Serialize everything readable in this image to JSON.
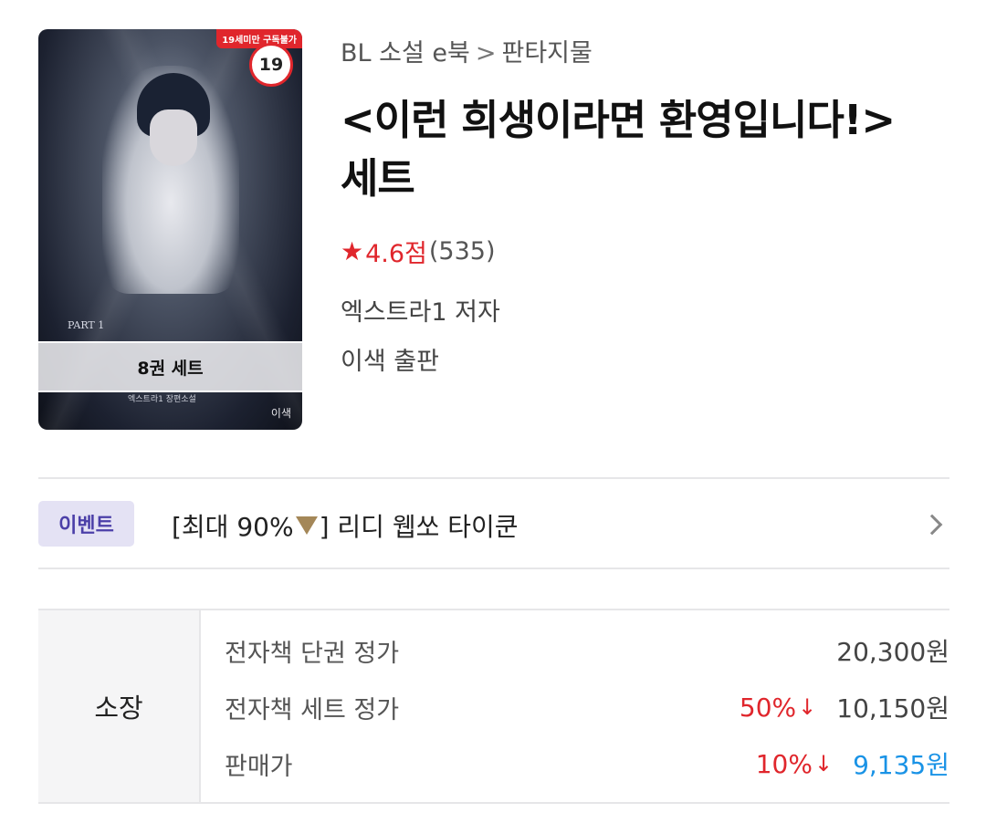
{
  "cover": {
    "age_label": "19세미만 구독불가",
    "age_badge": "19",
    "part_text": "PART 1",
    "author_text": "엑스트라1 장편소설",
    "publisher_text": "이색",
    "band_label": "8권 세트"
  },
  "breadcrumb": {
    "category": "BL 소설 e북",
    "separator": ">",
    "genre": "판타지물"
  },
  "book": {
    "title": "<이런 희생이라면 환영입니다!> 세트",
    "rating_star": "★",
    "rating_score": "4.6점",
    "rating_count": "(535)",
    "author": "엑스트라1 저자",
    "publisher": "이색 출판"
  },
  "event": {
    "badge": "이벤트",
    "text_before": "[최대 90%",
    "text_after": "] 리디 웹쏘 타이쿤",
    "accent_color": "#a48758"
  },
  "price": {
    "section_label": "소장",
    "rows": [
      {
        "label": "전자책 단권 정가",
        "discount": "",
        "value": "20,300원"
      },
      {
        "label": "전자책 세트 정가",
        "discount": "50%",
        "value": "10,150원"
      },
      {
        "label": "판매가",
        "discount": "10%",
        "value": "9,135원"
      }
    ],
    "discount_arrow": "↓"
  },
  "colors": {
    "red": "#e0262c",
    "sale_blue": "#1a93e6",
    "event_purple": "#4b3fa8"
  }
}
